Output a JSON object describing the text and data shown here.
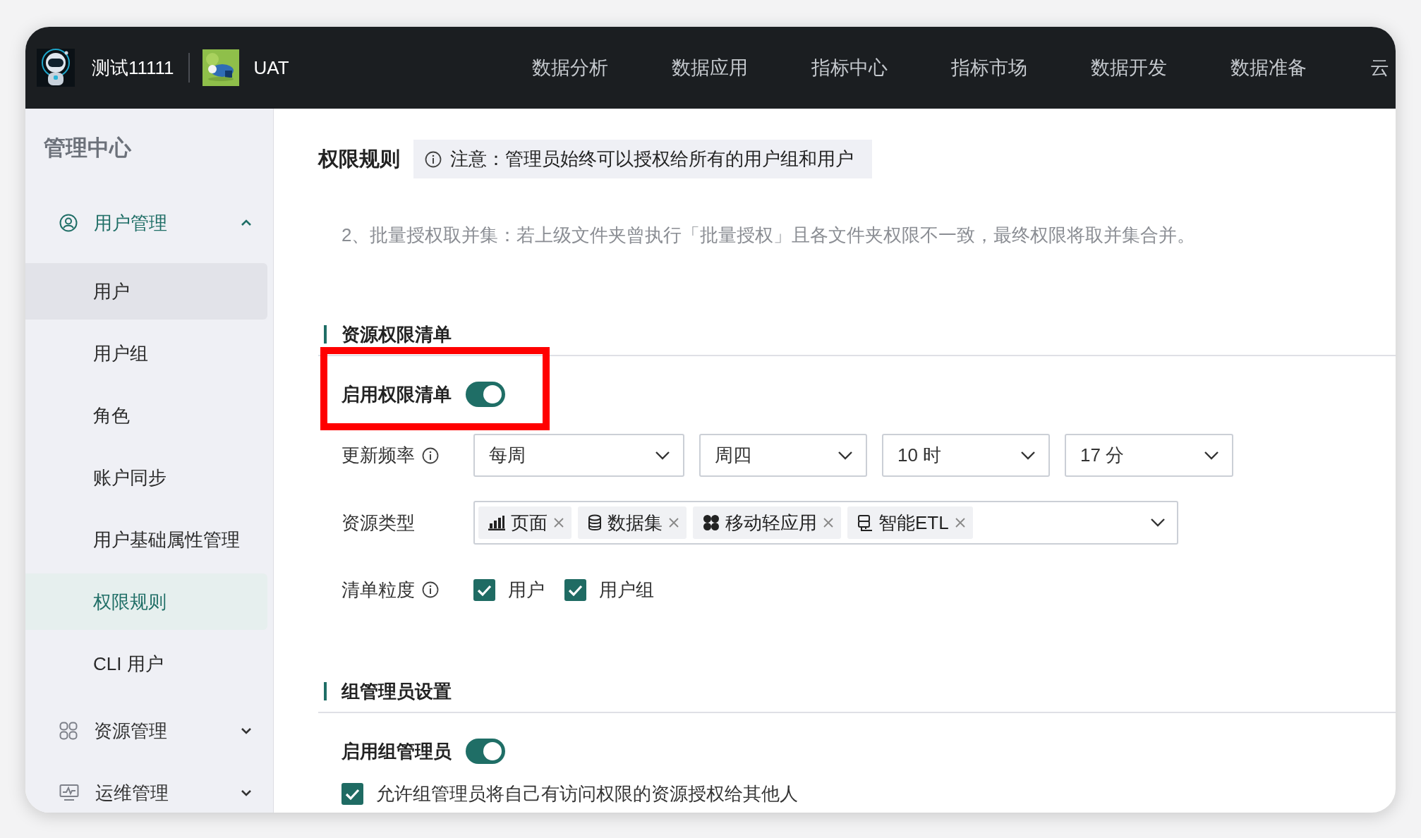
{
  "top_bar": {
    "workspace": "测试11111",
    "project": "UAT",
    "nav": [
      {
        "label": "数据分析"
      },
      {
        "label": "数据应用"
      },
      {
        "label": "指标中心"
      },
      {
        "label": "指标市场"
      },
      {
        "label": "数据开发"
      },
      {
        "label": "数据准备"
      },
      {
        "label": "云"
      }
    ]
  },
  "sidebar": {
    "title": "管理中心",
    "groups": [
      {
        "label": "用户管理",
        "kind": "user",
        "expanded": true,
        "selected": true,
        "children": [
          {
            "label": "用户",
            "selected": false,
            "hovered": true
          },
          {
            "label": "用户组",
            "selected": false,
            "hovered": false
          },
          {
            "label": "角色",
            "selected": false,
            "hovered": false
          },
          {
            "label": "账户同步",
            "selected": false,
            "hovered": false
          },
          {
            "label": "用户基础属性管理",
            "selected": false,
            "hovered": false
          },
          {
            "label": "权限规则",
            "selected": true,
            "hovered": false
          },
          {
            "label": "CLI 用户",
            "selected": false,
            "hovered": false
          }
        ]
      },
      {
        "label": "资源管理",
        "kind": "grid",
        "expanded": false,
        "selected": false
      },
      {
        "label": "运维管理",
        "kind": "monitor",
        "expanded": false,
        "selected": false
      }
    ]
  },
  "page": {
    "title": "权限规则",
    "notice": "注意：管理员始终可以授权给所有的用户组和用户",
    "note": "2、批量授权取并集：若上级文件夹曾执行「批量授权」且各文件夹权限不一致，最终权限将取并集合并。",
    "sections": [
      {
        "title": "资源权限清单",
        "fields": [
          {
            "kind": "toggle",
            "label": "启用权限清单",
            "on": true,
            "highlighted": true
          },
          {
            "kind": "selects",
            "label": "更新频率",
            "info": true,
            "options": [
              {
                "value": "每周"
              },
              {
                "value": "周四"
              },
              {
                "value": "10 时"
              },
              {
                "value": "17 分"
              }
            ]
          },
          {
            "kind": "tags",
            "label": "资源类型",
            "tags": [
              {
                "label": "页面",
                "kind": "page"
              },
              {
                "label": "数据集",
                "kind": "dataset"
              },
              {
                "label": "移动轻应用",
                "kind": "app"
              },
              {
                "label": "智能ETL",
                "kind": "etl"
              }
            ]
          },
          {
            "kind": "checks",
            "label": "清单粒度",
            "info": true,
            "items": [
              {
                "label": "用户",
                "checked": true
              },
              {
                "label": "用户组",
                "checked": true
              }
            ]
          }
        ]
      },
      {
        "title": "组管理员设置",
        "fields": [
          {
            "kind": "toggle",
            "label": "启用组管理员",
            "on": true,
            "highlighted": false
          },
          {
            "kind": "checks",
            "items": [
              {
                "label": "允许组管理员将自己有访问权限的资源授权给其他人",
                "checked": true
              }
            ]
          }
        ]
      }
    ]
  }
}
